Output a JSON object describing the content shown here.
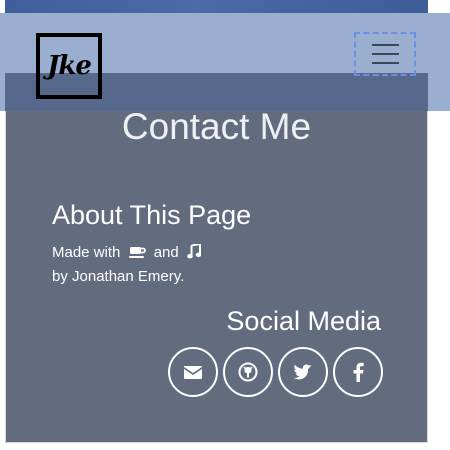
{
  "brand": {
    "logo_text": "Jke"
  },
  "navbar": {
    "toggler_icon": "hamburger-icon"
  },
  "contact": {
    "title": "Contact Me"
  },
  "about": {
    "title": "About This Page",
    "made_with": "Made with",
    "and": "and",
    "byline": "by Jonathan Emery.",
    "icon_1": "coffee-icon",
    "icon_2": "music-note-icon"
  },
  "social": {
    "title": "Social Media",
    "links": [
      {
        "icon": "envelope-icon"
      },
      {
        "icon": "github-icon"
      },
      {
        "icon": "twitter-icon"
      },
      {
        "icon": "facebook-icon"
      }
    ]
  },
  "colors": {
    "navbar_bg": "#9aaed0",
    "card_bg": "#636b7f",
    "hero_blue": "#4a6aa8",
    "toggler_border": "#6d8fe0",
    "text": "#ffffff"
  }
}
